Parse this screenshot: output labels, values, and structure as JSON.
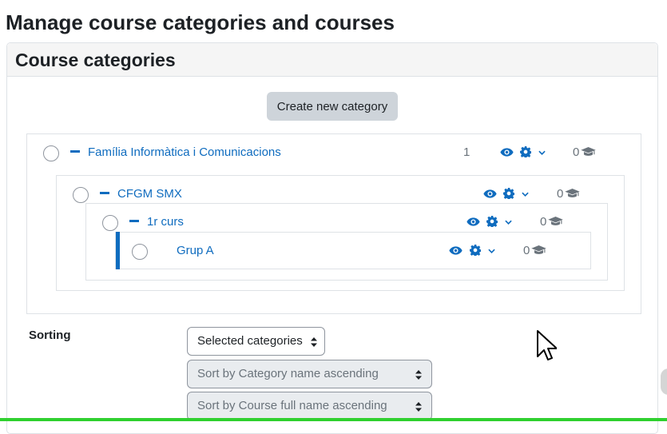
{
  "page": {
    "title": "Manage course categories and courses"
  },
  "card": {
    "title": "Course categories"
  },
  "actions": {
    "create_category": "Create new category"
  },
  "categories": [
    {
      "name": "Família Informàtica i Comunicacions",
      "subcategory_count": "1",
      "course_count": "0"
    },
    {
      "name": "CFGM SMX",
      "subcategory_count": "",
      "course_count": "0"
    },
    {
      "name": "1r curs",
      "subcategory_count": "",
      "course_count": "0"
    },
    {
      "name": "Grup A",
      "subcategory_count": "",
      "course_count": "0"
    }
  ],
  "sorting": {
    "label": "Sorting",
    "scope": "Selected categories",
    "category_sort": "Sort by Category name ascending",
    "course_sort": "Sort by Course full name ascending"
  },
  "icons": {
    "visibility": "eye-icon",
    "settings": "gear-icon",
    "menu": "chevron-down-icon",
    "courses": "graduation-cap-icon",
    "collapse": "minus-icon"
  },
  "colors": {
    "link": "#0f6cbf",
    "button": "#ced4da",
    "active_bar": "#0f6cbf"
  }
}
